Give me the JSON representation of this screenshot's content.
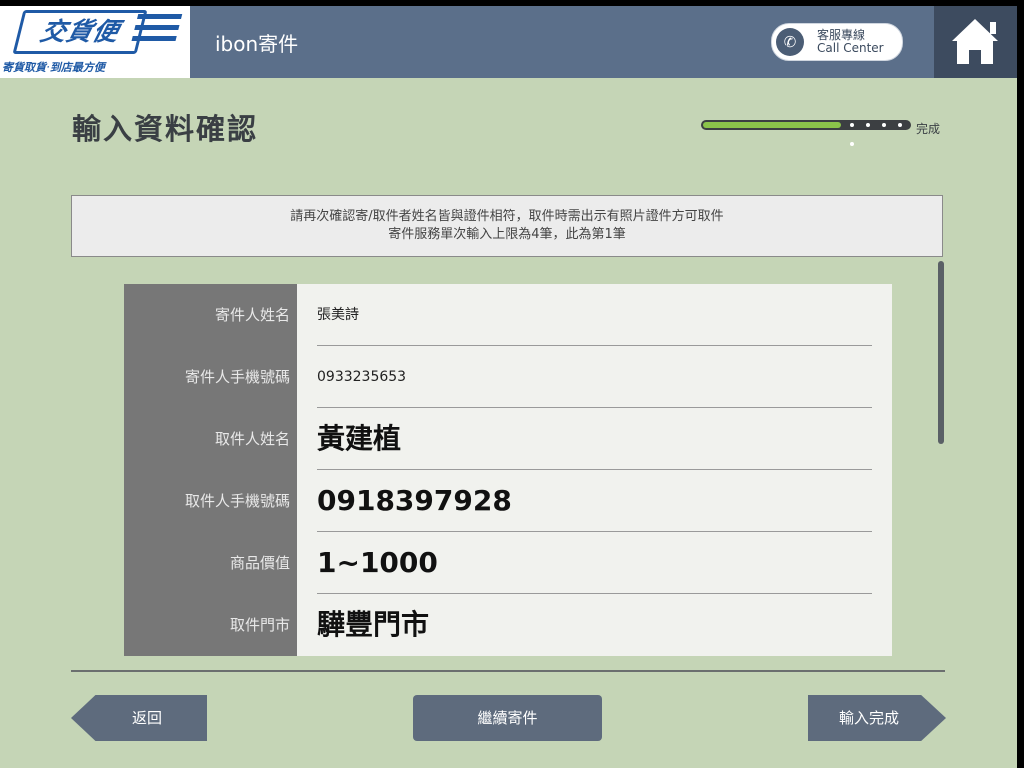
{
  "header": {
    "logo_text": "交貨便",
    "slogan": "寄貨取貨‧到店最方便",
    "title": "ibon寄件",
    "call_center": {
      "line1": "客服專線",
      "line2": "Call Center"
    }
  },
  "page": {
    "title": "輸入資料確認",
    "progress_label": "完成",
    "progress_fraction": 0.67
  },
  "notice": {
    "line1": "請再次確認寄/取件者姓名皆與證件相符，取件時需出示有照片證件方可取件",
    "line2": "寄件服務單次輸入上限為4筆，此為第1筆"
  },
  "form": {
    "rows": [
      {
        "label": "寄件人姓名",
        "value": "張美詩"
      },
      {
        "label": "寄件人手機號碼",
        "value": "0933235653"
      },
      {
        "label": "取件人姓名",
        "value": "黃建植"
      },
      {
        "label": "取件人手機號碼",
        "value": "0918397928"
      },
      {
        "label": "商品價值",
        "value": "1~1000"
      },
      {
        "label": "取件門市",
        "value": "驊豐門市"
      }
    ]
  },
  "buttons": {
    "back": "返回",
    "continue": "繼續寄件",
    "finish": "輸入完成"
  },
  "colors": {
    "background": "#c5d5b6",
    "header": "#5b6f8a",
    "progress": "#8bc34a",
    "button": "#5e6b7d"
  }
}
